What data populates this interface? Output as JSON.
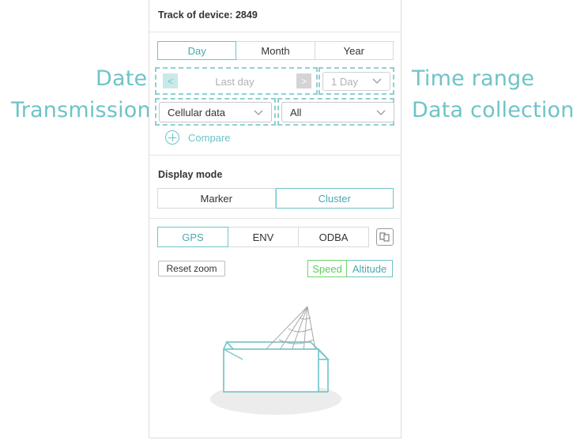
{
  "annotations": {
    "date": "Date",
    "transmission": "Transmission",
    "time_range": "Time range",
    "data_collection": "Data collection"
  },
  "panel": {
    "title": "Track of device: 2849",
    "period_tabs": [
      {
        "label": "Day",
        "active": true
      },
      {
        "label": "Month",
        "active": false
      },
      {
        "label": "Year",
        "active": false
      }
    ],
    "date_nav": {
      "prev_label": "<",
      "value": "Last  day",
      "next_label": ">"
    },
    "time_range_select": {
      "value": "1 Day"
    },
    "transmission_select": {
      "value": "Cellular data"
    },
    "collection_select": {
      "value": "All"
    },
    "compare_label": "Compare",
    "display_mode": {
      "label": "Display mode",
      "options": [
        {
          "label": "Marker",
          "active": false
        },
        {
          "label": "Cluster",
          "active": true
        }
      ]
    },
    "sensor_tabs": [
      {
        "label": "GPS",
        "active": true
      },
      {
        "label": "ENV",
        "active": false
      },
      {
        "label": "ODBA",
        "active": false
      }
    ],
    "reset_zoom_label": "Reset zoom",
    "metric_toggle": [
      {
        "label": "Speed",
        "color": "#6dd56d"
      },
      {
        "label": "Altitude",
        "color": "#6ec3c8"
      }
    ]
  },
  "colors": {
    "accent": "#6ec3c8",
    "speed_green": "#6dd56d"
  }
}
